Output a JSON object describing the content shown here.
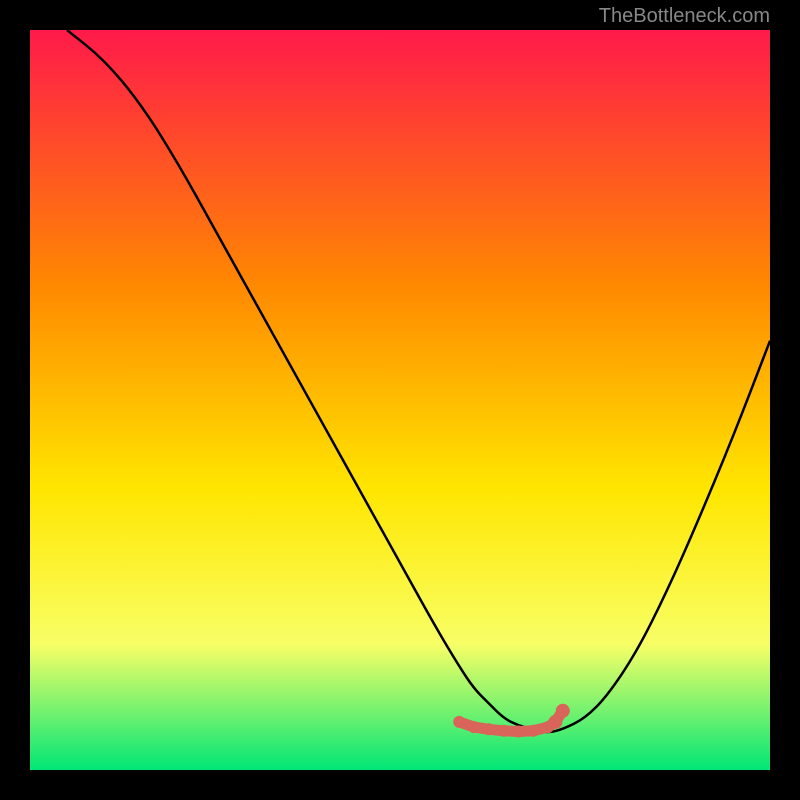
{
  "attribution": "TheBottleneck.com",
  "colors": {
    "gradient_top": "#ff1a4a",
    "gradient_mid1": "#ff8a00",
    "gradient_mid2": "#ffe600",
    "gradient_mid3": "#f8ff66",
    "gradient_bottom": "#00e676",
    "curve": "#000000",
    "marker": "#d9645a",
    "frame": "#000000"
  },
  "chart_data": {
    "type": "line",
    "title": "",
    "xlabel": "",
    "ylabel": "",
    "xlim": [
      0,
      100
    ],
    "ylim": [
      0,
      100
    ],
    "series": [
      {
        "name": "bottleneck-curve",
        "x": [
          5,
          10,
          15,
          20,
          25,
          30,
          35,
          40,
          45,
          50,
          55,
          58,
          60,
          62,
          64,
          66,
          68,
          70,
          72,
          75,
          78,
          82,
          86,
          90,
          95,
          100
        ],
        "y": [
          100,
          96,
          90,
          82,
          73,
          64,
          55,
          46,
          37,
          28,
          19,
          14,
          11,
          9,
          7,
          6,
          5.5,
          5,
          5.5,
          7,
          10,
          16,
          24,
          33,
          45,
          58
        ]
      }
    ],
    "markers": {
      "name": "optimal-range",
      "x": [
        58,
        60,
        62,
        64,
        66,
        68,
        70,
        71,
        72
      ],
      "y": [
        6.5,
        5.8,
        5.5,
        5.3,
        5.2,
        5.3,
        5.8,
        6.5,
        8
      ]
    }
  }
}
